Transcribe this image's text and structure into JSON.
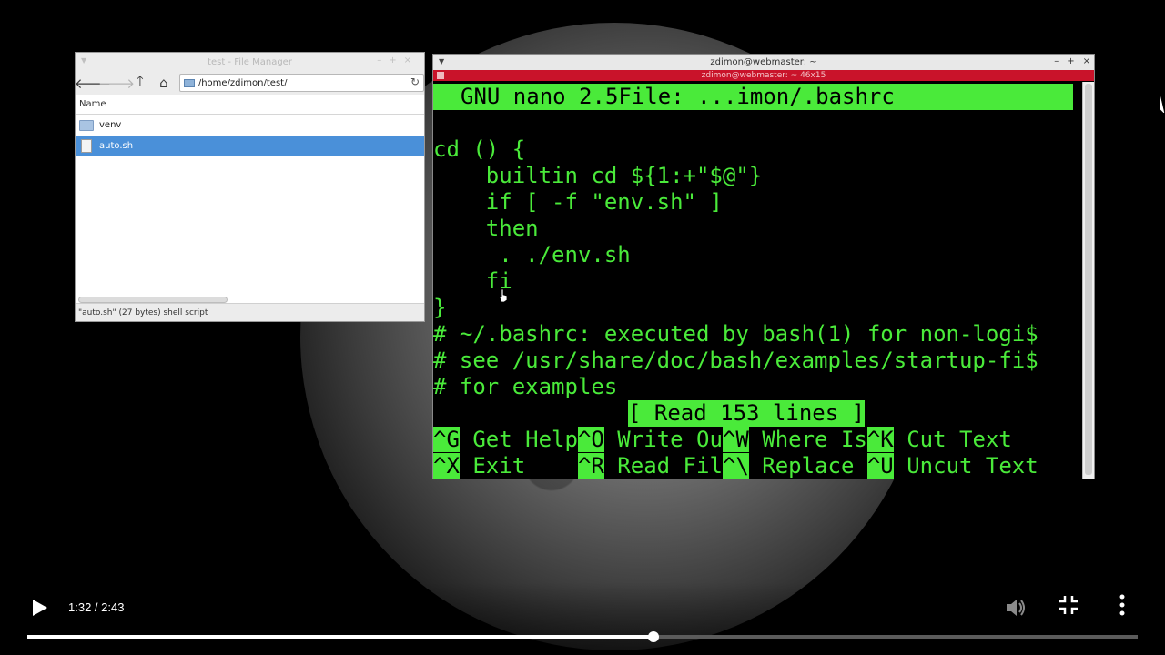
{
  "file_manager": {
    "title": "test - File Manager",
    "path": "/home/zdimon/test/",
    "column_name": "Name",
    "items": [
      {
        "name": "venv",
        "type": "folder",
        "selected": false
      },
      {
        "name": "auto.sh",
        "type": "file",
        "selected": true
      }
    ],
    "status": "\"auto.sh\" (27 bytes) shell script"
  },
  "terminal": {
    "title": "zdimon@webmaster: ~",
    "subtitle": "zdimon@webmaster: ~ 46x15",
    "nano_header": "GNU nano 2.5File: ...imon/.bashrc",
    "lines": [
      "",
      "cd () {",
      "    builtin cd ${1:+\"$@\"}",
      "    if [ -f \"env.sh\" ]",
      "    then",
      "     . ./env.sh",
      "    fi",
      "}",
      "# ~/.bashrc: executed by bash(1) for non-logi$",
      "# see /usr/share/doc/bash/examples/startup-fi$",
      "# for examples"
    ],
    "status_message": "[ Read 153 lines ]",
    "shortcuts_row1": [
      {
        "key": "^G",
        "label": " Get Help"
      },
      {
        "key": "^O",
        "label": " Write Ou"
      },
      {
        "key": "^W",
        "label": " Where Is"
      },
      {
        "key": "^K",
        "label": " Cut Text"
      }
    ],
    "shortcuts_row2": [
      {
        "key": "^X",
        "label": " Exit    "
      },
      {
        "key": "^R",
        "label": " Read Fil"
      },
      {
        "key": "^\\",
        "label": " Replace "
      },
      {
        "key": "^U",
        "label": " Uncut Text"
      }
    ]
  },
  "player": {
    "time": "1:32 / 2:43",
    "progress_fraction": 0.564
  }
}
